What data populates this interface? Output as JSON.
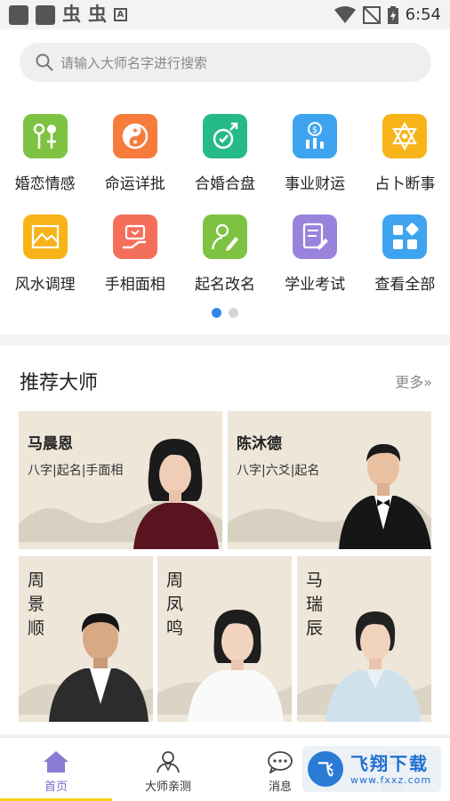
{
  "status_bar": {
    "time": "6:54"
  },
  "search": {
    "placeholder": "请输入大师名字进行搜索"
  },
  "categories": [
    {
      "label": "婚恋情感",
      "color": "#7ec242",
      "icon": "love-tree-icon"
    },
    {
      "label": "命运详批",
      "color": "#f77b3a",
      "icon": "yin-yang-icon"
    },
    {
      "label": "合婚合盘",
      "color": "#26b98a",
      "icon": "marriage-ring-icon"
    },
    {
      "label": "事业财运",
      "color": "#3ea4f0",
      "icon": "money-chart-icon"
    },
    {
      "label": "占卜断事",
      "color": "#f7b318",
      "icon": "hexagram-icon"
    },
    {
      "label": "风水调理",
      "color": "#f7b318",
      "icon": "landscape-icon"
    },
    {
      "label": "手相面相",
      "color": "#f46f5a",
      "icon": "palm-icon"
    },
    {
      "label": "起名改名",
      "color": "#7ec242",
      "icon": "name-pen-icon"
    },
    {
      "label": "学业考试",
      "color": "#9a83dc",
      "icon": "exam-paper-icon"
    },
    {
      "label": "查看全部",
      "color": "#3ea4f0",
      "icon": "all-grid-icon"
    }
  ],
  "recommend": {
    "title": "推荐大师",
    "more": "更多»",
    "masters": [
      {
        "name": "马晨恩",
        "tags": "八字|起名|手面相"
      },
      {
        "name": "陈沐德",
        "tags": "八字|六爻|起名"
      },
      {
        "name": "周景顺"
      },
      {
        "name": "周凤鸣"
      },
      {
        "name": "马瑞辰"
      }
    ]
  },
  "nav": [
    {
      "label": "首页",
      "icon": "home-icon"
    },
    {
      "label": "大师亲测",
      "icon": "master-icon"
    },
    {
      "label": "消息",
      "icon": "message-icon"
    },
    {
      "label": "我的",
      "icon": "profile-icon"
    }
  ],
  "watermark": {
    "brand": "飞翔下载",
    "url": "www.fxxz.com",
    "logo": "飞"
  },
  "colors": {
    "accent": "#7b68c8",
    "underline": "#f3d21c",
    "dot_active": "#2f86e8"
  }
}
